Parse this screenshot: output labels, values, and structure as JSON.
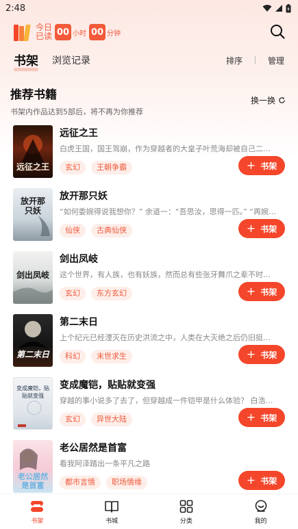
{
  "status_bar": {
    "time": "2:48"
  },
  "header": {
    "reading_label": "今日已读",
    "hours": "00",
    "hours_unit": "小时",
    "minutes": "00",
    "minutes_unit": "分钟"
  },
  "tabs": {
    "bookshelf": "书架",
    "history": "浏览记录",
    "sort": "排序",
    "manage": "管理"
  },
  "recommend": {
    "title": "推荐书籍",
    "note": "书架内作品达到5部后，将不再为你推荐",
    "swap_label": "换一换"
  },
  "books": [
    {
      "title": "远征之王",
      "desc": "白虎王国，国王驾崩，作为穿越者的大皇子叶荒海却被自己二…",
      "tags": [
        "玄幻",
        "王朝争霸"
      ],
      "add_label": "书架",
      "cover_text": "远征之王"
    },
    {
      "title": "放开那只妖",
      "desc": "“如何委婉得说我想你？” 余道一：“吾思汝，思得一匹。” “再婉…",
      "tags": [
        "仙侠",
        "古典仙侠"
      ],
      "add_label": "书架",
      "cover_text": "放开那只妖"
    },
    {
      "title": "剑出凤岐",
      "desc": "这个世界，有人族，也有妖族，然而总有些张牙舞爪之辈不时…",
      "tags": [
        "玄幻",
        "东方玄幻"
      ],
      "add_label": "书架",
      "cover_text": "剑出凤岐"
    },
    {
      "title": "第二末日",
      "desc": "上个纪元已经湮灭在历史洪流之中，人类在大灭绝之后仍旧挺…",
      "tags": [
        "科幻",
        "末世求生"
      ],
      "add_label": "书架",
      "cover_text": "第二末日"
    },
    {
      "title": "变成魔铠，贴贴就变强",
      "desc": "穿越的事小说多了去了，但穿越成一件铠甲是什么体验？ 白浩…",
      "tags": [
        "玄幻",
        "异世大陆"
      ],
      "add_label": "书架",
      "cover_text": "变成魔铠，贴贴就变强"
    },
    {
      "title": "老公居然是首富",
      "desc": "看我阿泽踏出一条平凡之路",
      "tags": [
        "都市言情",
        "职场情缘"
      ],
      "add_label": "书架",
      "cover_text": "老公居然是首富"
    }
  ],
  "bottom_nav": [
    {
      "label": "书架",
      "icon": "bookshelf-icon",
      "active": true
    },
    {
      "label": "书城",
      "icon": "book-open-icon",
      "active": false
    },
    {
      "label": "分类",
      "icon": "grid-icon",
      "active": false
    },
    {
      "label": "我的",
      "icon": "profile-icon",
      "active": false
    }
  ],
  "colors": {
    "accent": "#f4462a",
    "tag_bg": "#fdeee9",
    "tag_text": "#ef5a3c"
  }
}
